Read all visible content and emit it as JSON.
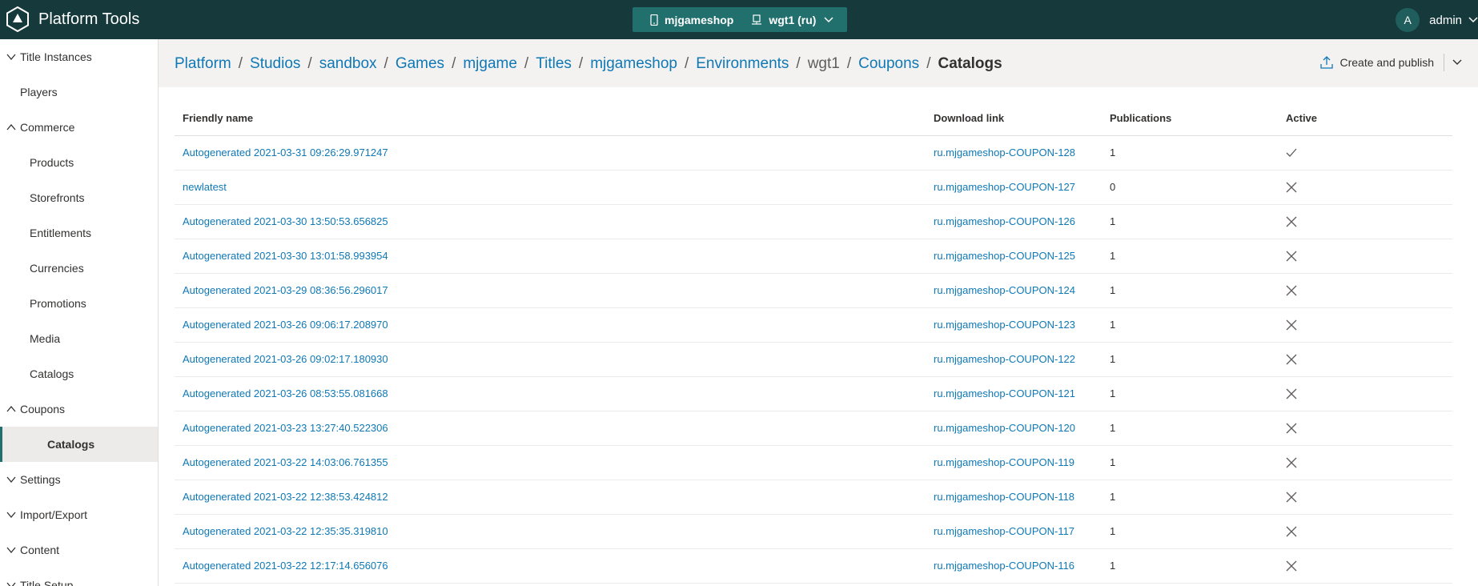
{
  "app": {
    "title": "Platform Tools"
  },
  "context": {
    "title_name": "mjgameshop",
    "environment": "wgt1 (ru)"
  },
  "user": {
    "initial": "A",
    "name": "admin"
  },
  "sidebar": {
    "items": [
      {
        "label": "Title Instances",
        "level": 0,
        "chevron": "down"
      },
      {
        "label": "Players",
        "level": 1
      },
      {
        "label": "Commerce",
        "level": 0,
        "chevron": "up"
      },
      {
        "label": "Products",
        "level": 2
      },
      {
        "label": "Storefronts",
        "level": 2
      },
      {
        "label": "Entitlements",
        "level": 2
      },
      {
        "label": "Currencies",
        "level": 2
      },
      {
        "label": "Promotions",
        "level": 2
      },
      {
        "label": "Media",
        "level": 2
      },
      {
        "label": "Catalogs",
        "level": 2
      },
      {
        "label": "Coupons",
        "level": 1,
        "chevron": "up"
      },
      {
        "label": "Catalogs",
        "level": 3,
        "active": true
      },
      {
        "label": "Settings",
        "level": 1,
        "chevron": "down"
      },
      {
        "label": "Import/Export",
        "level": 1,
        "chevron": "down"
      },
      {
        "label": "Content",
        "level": 0,
        "chevron": "down"
      },
      {
        "label": "Title Setup",
        "level": 0,
        "chevron": "down"
      }
    ]
  },
  "breadcrumb": {
    "items": [
      {
        "label": "Platform",
        "kind": "link"
      },
      {
        "label": "Studios",
        "kind": "link"
      },
      {
        "label": "sandbox",
        "kind": "link"
      },
      {
        "label": "Games",
        "kind": "link"
      },
      {
        "label": "mjgame",
        "kind": "link"
      },
      {
        "label": "Titles",
        "kind": "link"
      },
      {
        "label": "mjgameshop",
        "kind": "link"
      },
      {
        "label": "Environments",
        "kind": "link"
      },
      {
        "label": "wgt1",
        "kind": "plain"
      },
      {
        "label": "Coupons",
        "kind": "link"
      },
      {
        "label": "Catalogs",
        "kind": "current"
      }
    ],
    "separator": "/"
  },
  "actions": {
    "create_publish_label": "Create and publish"
  },
  "table": {
    "columns": [
      "Friendly name",
      "Download link",
      "Publications",
      "Active"
    ],
    "rows": [
      {
        "name": "Autogenerated 2021-03-31 09:26:29.971247",
        "link": "ru.mjgameshop-COUPON-128",
        "publications": "1",
        "active": true
      },
      {
        "name": "newlatest",
        "link": "ru.mjgameshop-COUPON-127",
        "publications": "0",
        "active": false
      },
      {
        "name": "Autogenerated 2021-03-30 13:50:53.656825",
        "link": "ru.mjgameshop-COUPON-126",
        "publications": "1",
        "active": false
      },
      {
        "name": "Autogenerated 2021-03-30 13:01:58.993954",
        "link": "ru.mjgameshop-COUPON-125",
        "publications": "1",
        "active": false
      },
      {
        "name": "Autogenerated 2021-03-29 08:36:56.296017",
        "link": "ru.mjgameshop-COUPON-124",
        "publications": "1",
        "active": false
      },
      {
        "name": "Autogenerated 2021-03-26 09:06:17.208970",
        "link": "ru.mjgameshop-COUPON-123",
        "publications": "1",
        "active": false
      },
      {
        "name": "Autogenerated 2021-03-26 09:02:17.180930",
        "link": "ru.mjgameshop-COUPON-122",
        "publications": "1",
        "active": false
      },
      {
        "name": "Autogenerated 2021-03-26 08:53:55.081668",
        "link": "ru.mjgameshop-COUPON-121",
        "publications": "1",
        "active": false
      },
      {
        "name": "Autogenerated 2021-03-23 13:27:40.522306",
        "link": "ru.mjgameshop-COUPON-120",
        "publications": "1",
        "active": false
      },
      {
        "name": "Autogenerated 2021-03-22 14:03:06.761355",
        "link": "ru.mjgameshop-COUPON-119",
        "publications": "1",
        "active": false
      },
      {
        "name": "Autogenerated 2021-03-22 12:38:53.424812",
        "link": "ru.mjgameshop-COUPON-118",
        "publications": "1",
        "active": false
      },
      {
        "name": "Autogenerated 2021-03-22 12:35:35.319810",
        "link": "ru.mjgameshop-COUPON-117",
        "publications": "1",
        "active": false
      },
      {
        "name": "Autogenerated 2021-03-22 12:17:14.656076",
        "link": "ru.mjgameshop-COUPON-116",
        "publications": "1",
        "active": false
      }
    ]
  },
  "colors": {
    "topbar": "#16393b",
    "context": "#22706e",
    "link": "#0f78b5"
  }
}
